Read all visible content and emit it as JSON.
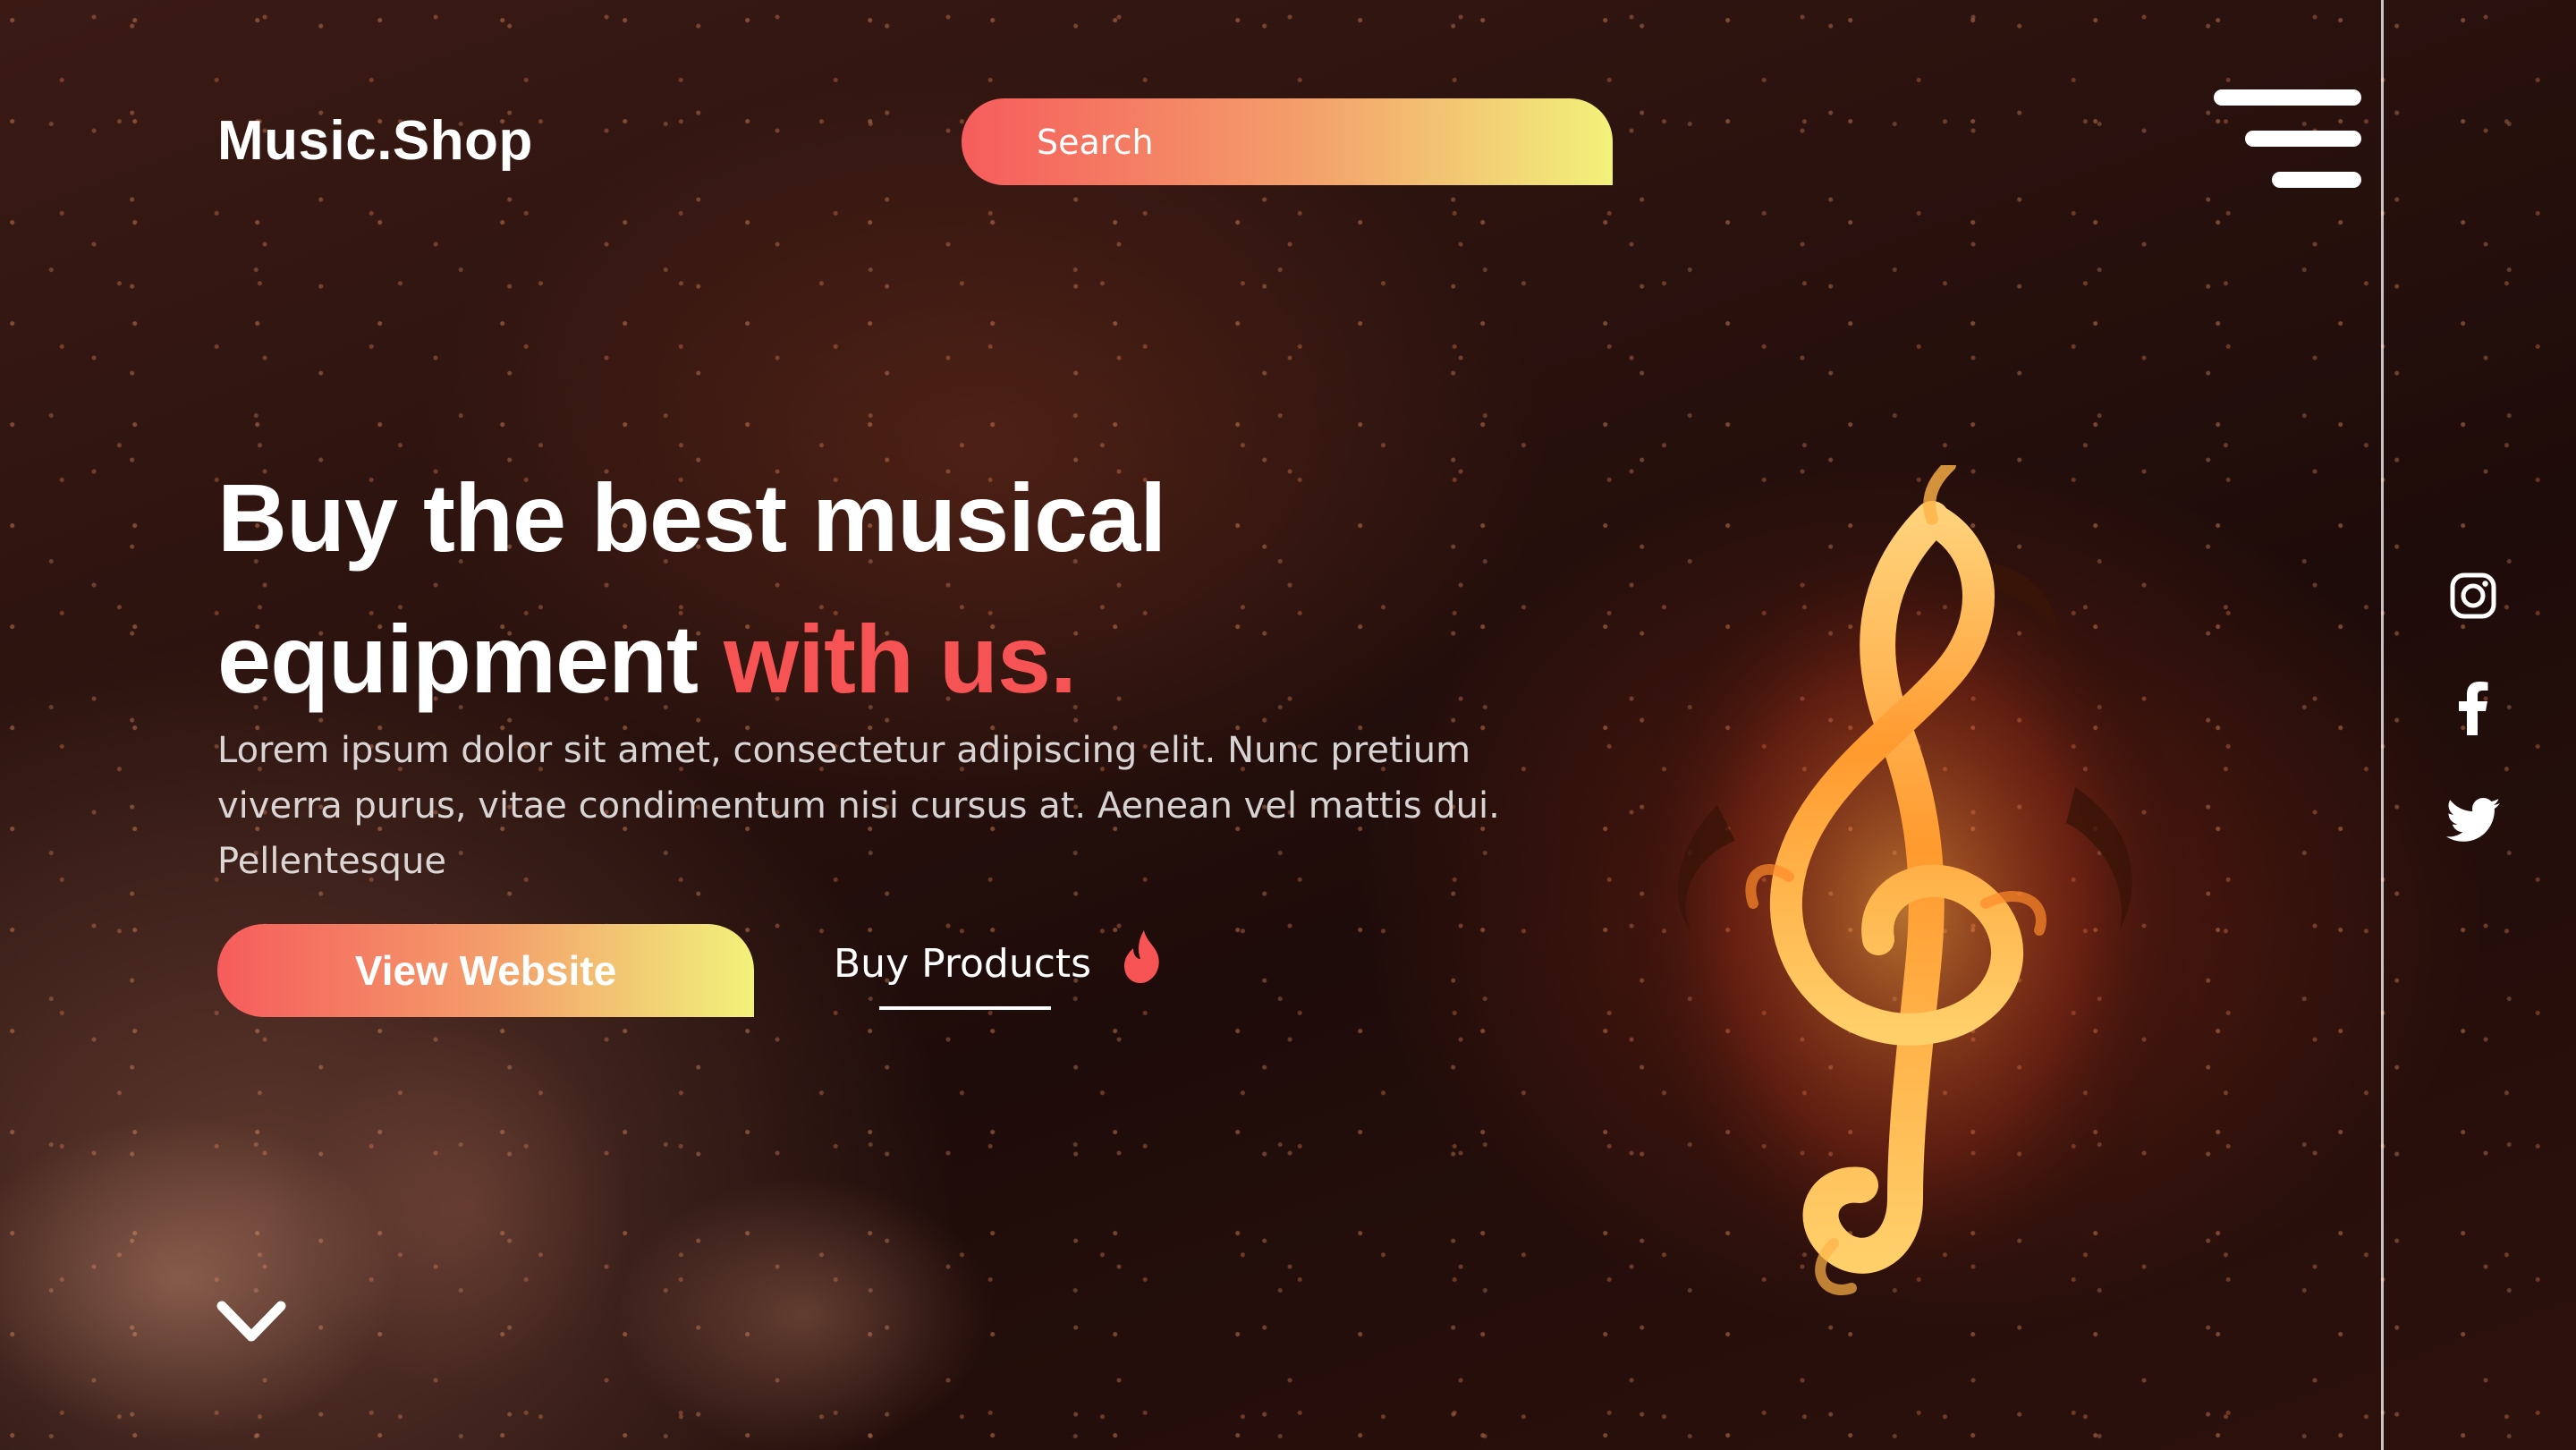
{
  "header": {
    "logo": "Music.Shop",
    "search_placeholder": "Search"
  },
  "hero": {
    "headline_line1": "Buy the best musical",
    "headline_line2_plain": "equipment ",
    "headline_line2_accent": "with us.",
    "description": "Lorem ipsum dolor sit amet, consectetur adipiscing elit. Nunc pretium viverra purus, vitae condimentum nisi cursus at. Aenean vel mattis dui. Pellentesque",
    "primary_button": "View Website",
    "secondary_link": "Buy Products"
  },
  "social": [
    "instagram-icon",
    "facebook-icon",
    "twitter-icon"
  ],
  "colors": {
    "accent": "#f65354",
    "gradient_start": "#f65c5c",
    "gradient_mid": "#f3a36c",
    "gradient_end": "#f2f27a",
    "text": "#ffffff"
  },
  "icons": {
    "menu": "hamburger-menu-icon",
    "flame": "flame-icon",
    "scroll": "chevron-down-icon",
    "hero_image": "flaming-treble-clef"
  }
}
